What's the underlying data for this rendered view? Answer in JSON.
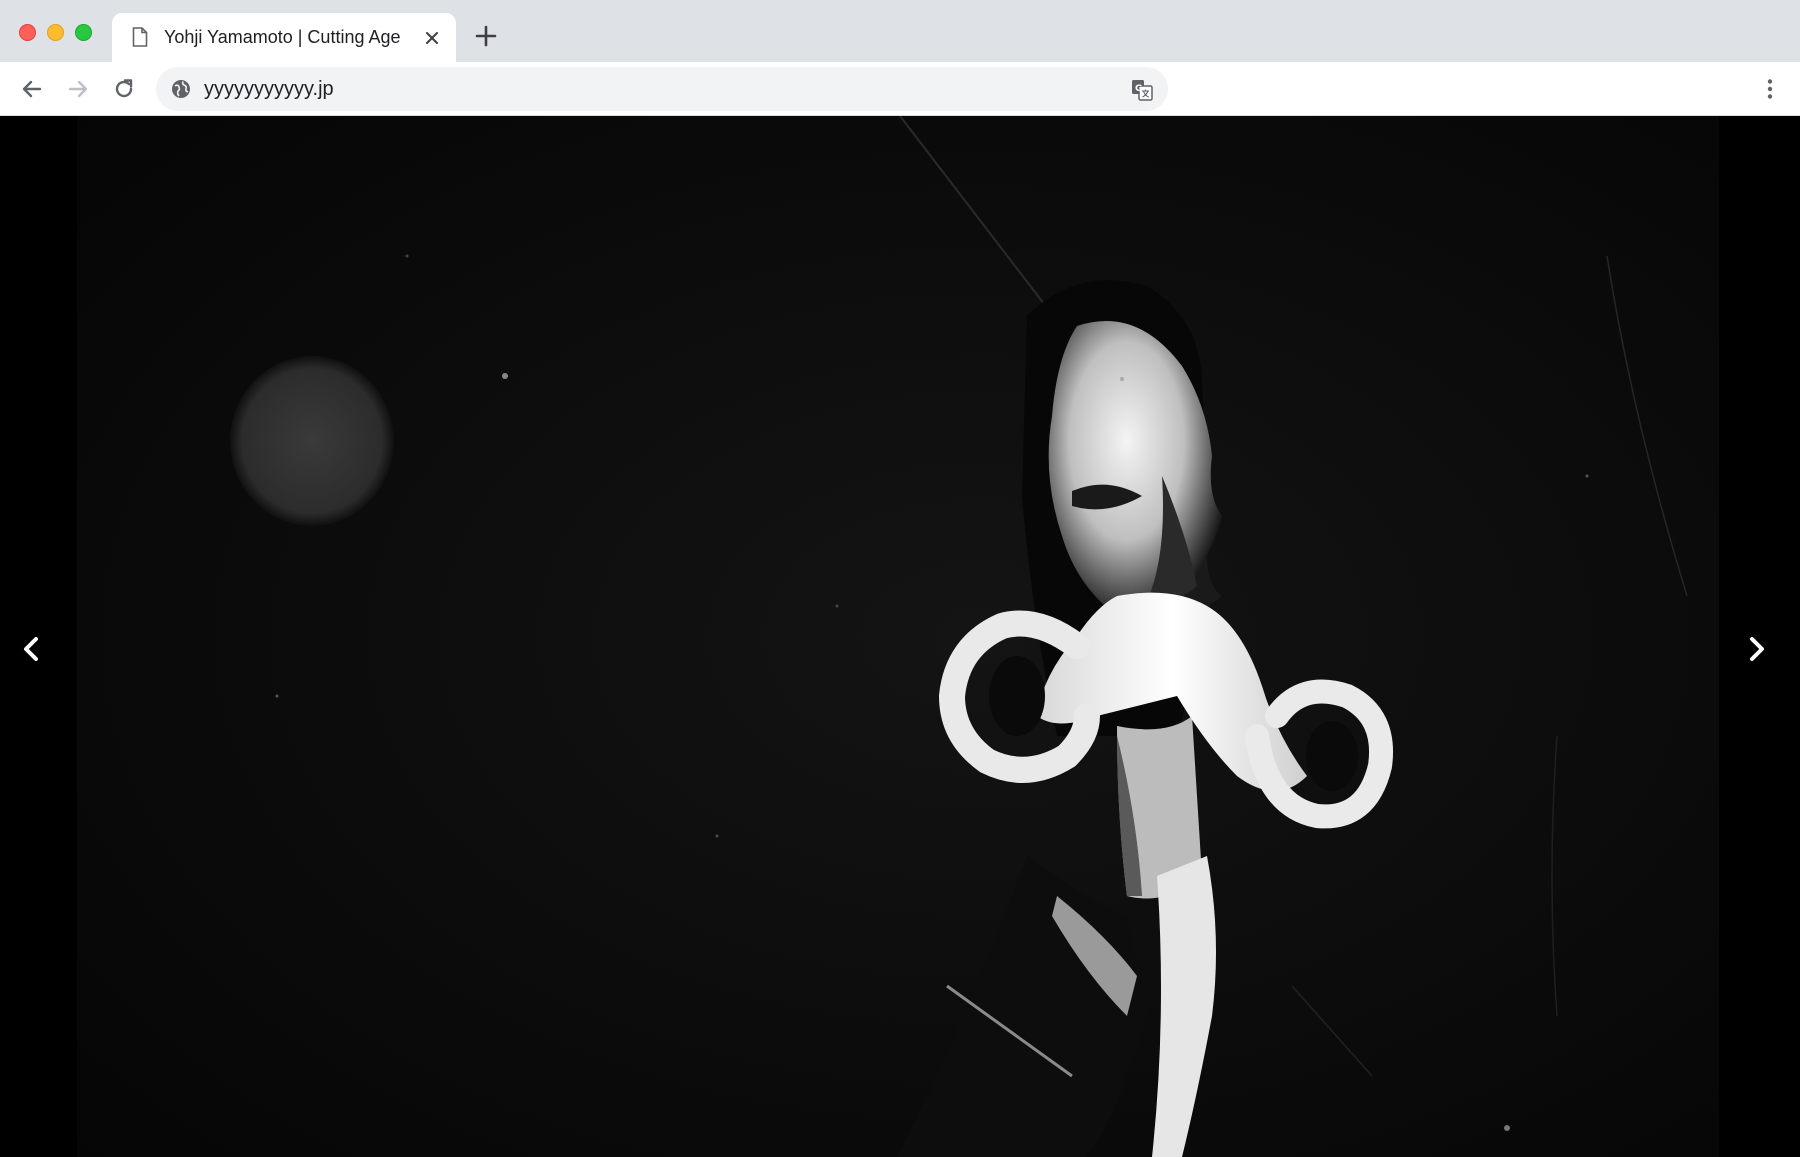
{
  "window": {
    "controls": [
      "close",
      "minimize",
      "zoom"
    ]
  },
  "tabs": [
    {
      "title": "Yohji Yamamoto | Cutting Age",
      "icon": "document-icon",
      "active": true
    }
  ],
  "toolbar": {
    "url": "yyyyyyyyyyy.jp",
    "icons": [
      "back-icon",
      "forward-icon",
      "reload-icon",
      "globe-icon",
      "translate-icon",
      "more-menu-icon"
    ]
  },
  "viewer": {
    "image_subject": "black-and-white portrait photograph",
    "prev_glyph": "‹",
    "next_glyph": "›"
  },
  "colors": {
    "tabstrip": "#dee1e6",
    "toolbar": "#ffffff",
    "omnibox": "#f1f3f4",
    "viewer_bg": "#000000"
  }
}
